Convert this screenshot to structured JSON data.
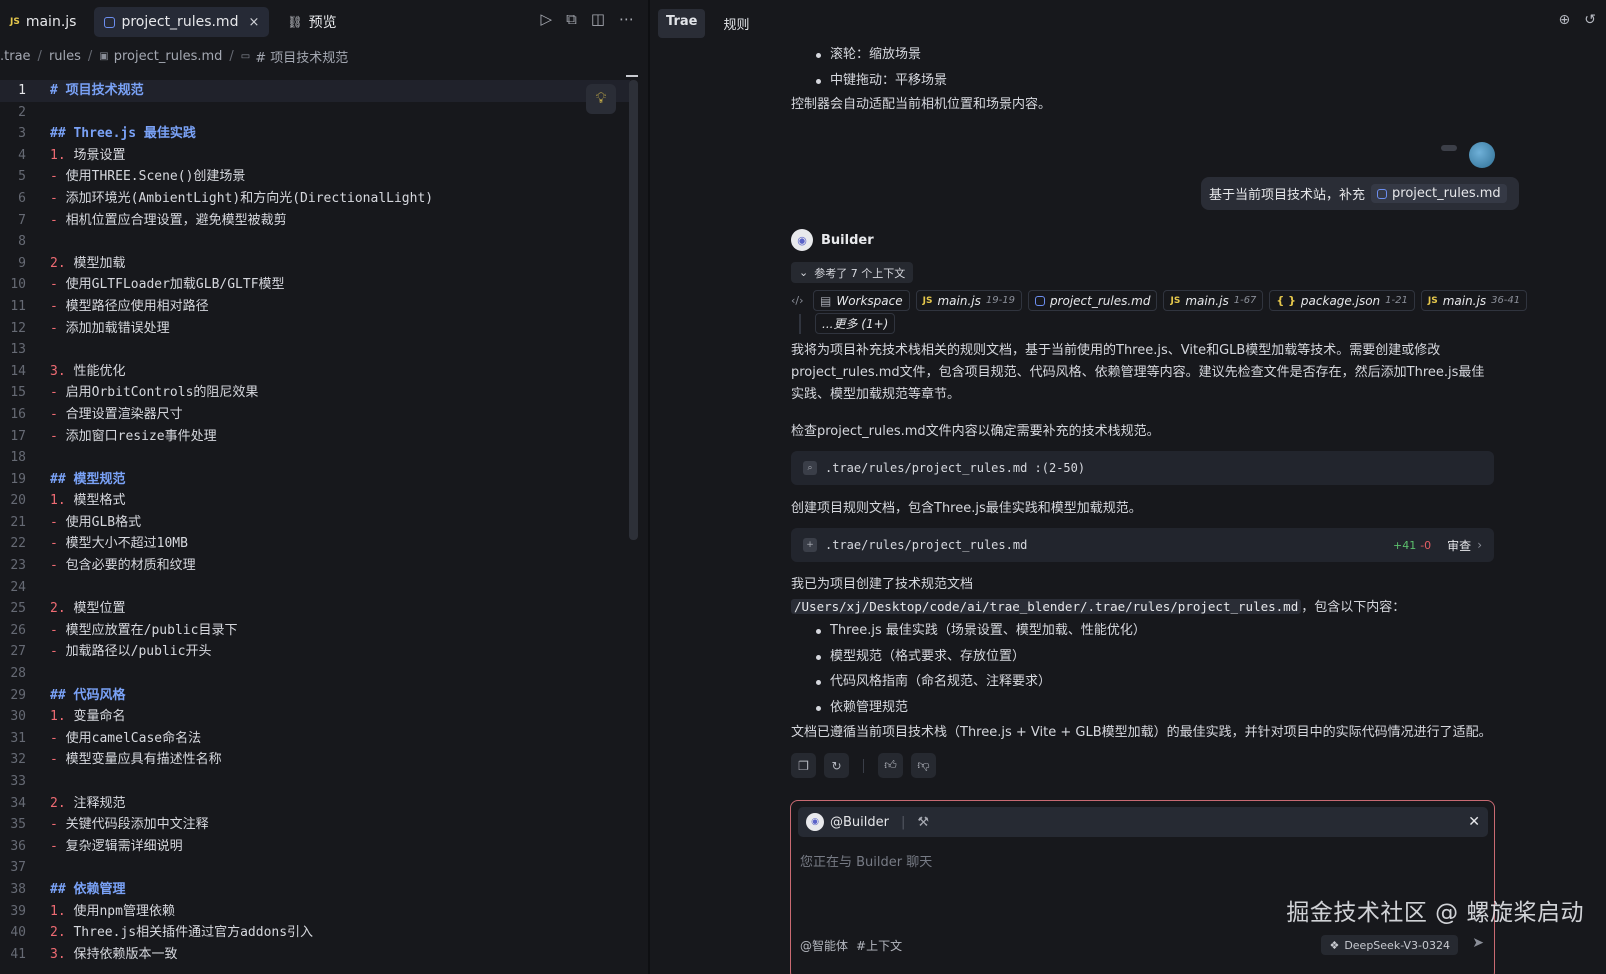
{
  "editor": {
    "tabs": [
      {
        "label": "main.js",
        "badge": "JS",
        "active": false
      },
      {
        "label": "project_rules.md",
        "active": true,
        "close": "×"
      },
      {
        "label": "预览",
        "icon": "link-icon"
      }
    ],
    "breadcrumb": [
      ".trae",
      "rules",
      "project_rules.md",
      "# 项目技术规范"
    ],
    "lines": [
      {
        "n": "1",
        "t": "# 项目技术规范",
        "k": "h1"
      },
      {
        "n": "2",
        "t": "",
        "k": ""
      },
      {
        "n": "3",
        "t": "## Three.js 最佳实践",
        "k": "h2"
      },
      {
        "n": "4",
        "m": "1.",
        "t": " 场景设置",
        "k": ""
      },
      {
        "n": "5",
        "m": "-",
        "t": " 使用THREE.Scene()创建场景",
        "k": ""
      },
      {
        "n": "6",
        "m": "-",
        "t": " 添加环境光(AmbientLight)和方向光(DirectionalLight)",
        "k": ""
      },
      {
        "n": "7",
        "m": "-",
        "t": " 相机位置应合理设置，避免模型被裁剪",
        "k": ""
      },
      {
        "n": "8",
        "t": "",
        "k": ""
      },
      {
        "n": "9",
        "m": "2.",
        "t": " 模型加载",
        "k": ""
      },
      {
        "n": "10",
        "m": "-",
        "t": " 使用GLTFLoader加载GLB/GLTF模型",
        "k": ""
      },
      {
        "n": "11",
        "m": "-",
        "t": " 模型路径应使用相对路径",
        "k": ""
      },
      {
        "n": "12",
        "m": "-",
        "t": " 添加加载错误处理",
        "k": ""
      },
      {
        "n": "13",
        "t": "",
        "k": ""
      },
      {
        "n": "14",
        "m": "3.",
        "t": " 性能优化",
        "k": ""
      },
      {
        "n": "15",
        "m": "-",
        "t": " 启用OrbitControls的阻尼效果",
        "k": ""
      },
      {
        "n": "16",
        "m": "-",
        "t": " 合理设置渲染器尺寸",
        "k": ""
      },
      {
        "n": "17",
        "m": "-",
        "t": " 添加窗口resize事件处理",
        "k": ""
      },
      {
        "n": "18",
        "t": "",
        "k": ""
      },
      {
        "n": "19",
        "t": "## 模型规范",
        "k": "h2"
      },
      {
        "n": "20",
        "m": "1.",
        "t": " 模型格式",
        "k": ""
      },
      {
        "n": "21",
        "m": "-",
        "t": " 使用GLB格式",
        "k": ""
      },
      {
        "n": "22",
        "m": "-",
        "t": " 模型大小不超过10MB",
        "k": ""
      },
      {
        "n": "23",
        "m": "-",
        "t": " 包含必要的材质和纹理",
        "k": ""
      },
      {
        "n": "24",
        "t": "",
        "k": ""
      },
      {
        "n": "25",
        "m": "2.",
        "t": " 模型位置",
        "k": ""
      },
      {
        "n": "26",
        "m": "-",
        "t": " 模型应放置在/public目录下",
        "k": ""
      },
      {
        "n": "27",
        "m": "-",
        "t": " 加载路径以/public开头",
        "k": ""
      },
      {
        "n": "28",
        "t": "",
        "k": ""
      },
      {
        "n": "29",
        "t": "## 代码风格",
        "k": "h2"
      },
      {
        "n": "30",
        "m": "1.",
        "t": " 变量命名",
        "k": ""
      },
      {
        "n": "31",
        "m": "-",
        "t": " 使用camelCase命名法",
        "k": ""
      },
      {
        "n": "32",
        "m": "-",
        "t": " 模型变量应具有描述性名称",
        "k": ""
      },
      {
        "n": "33",
        "t": "",
        "k": ""
      },
      {
        "n": "34",
        "m": "2.",
        "t": " 注释规范",
        "k": ""
      },
      {
        "n": "35",
        "m": "-",
        "t": " 关键代码段添加中文注释",
        "k": ""
      },
      {
        "n": "36",
        "m": "-",
        "t": " 复杂逻辑需详细说明",
        "k": ""
      },
      {
        "n": "37",
        "t": "",
        "k": ""
      },
      {
        "n": "38",
        "t": "## 依赖管理",
        "k": "h2"
      },
      {
        "n": "39",
        "m": "1.",
        "t": " 使用npm管理依赖",
        "k": ""
      },
      {
        "n": "40",
        "m": "2.",
        "t": " Three.js相关插件通过官方addons引入",
        "k": ""
      },
      {
        "n": "41",
        "m": "3.",
        "t": " 保持依赖版本一致",
        "k": ""
      }
    ]
  },
  "chat": {
    "tabs": [
      {
        "label": "Trae",
        "active": true
      },
      {
        "label": "规则",
        "active": false
      }
    ],
    "top_bullets": [
      "滚轮：缩放场景",
      "中键拖动：平移场景"
    ],
    "top_para": "控制器会自动适配当前相机位置和场景内容。",
    "user_message": {
      "text": "基于当前项目技术站，补充",
      "file": "project_rules.md"
    },
    "builder_name": "Builder",
    "context_toggle": "参考了 7 个上下文",
    "context_chips": [
      {
        "label": "Workspace",
        "range": "",
        "icon": "workspace"
      },
      {
        "label": "main.js",
        "range": "19-19",
        "icon": "js"
      },
      {
        "label": "project_rules.md",
        "range": "",
        "icon": "md"
      },
      {
        "label": "main.js",
        "range": "1-67",
        "icon": "js"
      },
      {
        "label": "package.json",
        "range": "1-21",
        "icon": "json"
      },
      {
        "label": "main.js",
        "range": "36-41",
        "icon": "js"
      }
    ],
    "context_more": "...更多 (1+)",
    "para1": "我将为项目补充技术栈相关的规则文档，基于当前使用的Three.js、Vite和GLB模型加载等技术。需要创建或修改project_rules.md文件，包含项目规范、代码风格、依赖管理等内容。建议先检查文件是否存在，然后添加Three.js最佳实践、模型加载规范等章节。",
    "para2": "检查project_rules.md文件内容以确定需要补充的技术栈规范。",
    "tool1": {
      "path": ".trae/rules/project_rules.md :(2-50)"
    },
    "para3": "创建项目规则文档，包含Three.js最佳实践和模型加载规范。",
    "tool2": {
      "path": ".trae/rules/project_rules.md",
      "add": "+41",
      "del": "-0",
      "action": "审查"
    },
    "para4_prefix": "我已为项目创建了技术规范文档",
    "para4_code": "/Users/xj/Desktop/code/ai/trae_blender/.trae/rules/project_rules.md",
    "para4_suffix": "，包含以下内容：",
    "summary_bullets": [
      "Three.js 最佳实践（场景设置、模型加载、性能优化）",
      "模型规范（格式要求、存放位置）",
      "代码风格指南（命名规范、注释要求）",
      "依赖管理规范"
    ],
    "para5": "文档已遵循当前项目技术栈（Three.js + Vite + GLB模型加载）的最佳实践，并针对项目中的实际代码情况进行了适配。",
    "input": {
      "agent": "@Builder",
      "placeholder": "您正在与 Builder 聊天",
      "foot_agent": "@智能体",
      "foot_context": "#上下文",
      "model": "DeepSeek-V3-0324"
    }
  },
  "watermark": "掘金技术社区 @ 螺旋桨启动"
}
